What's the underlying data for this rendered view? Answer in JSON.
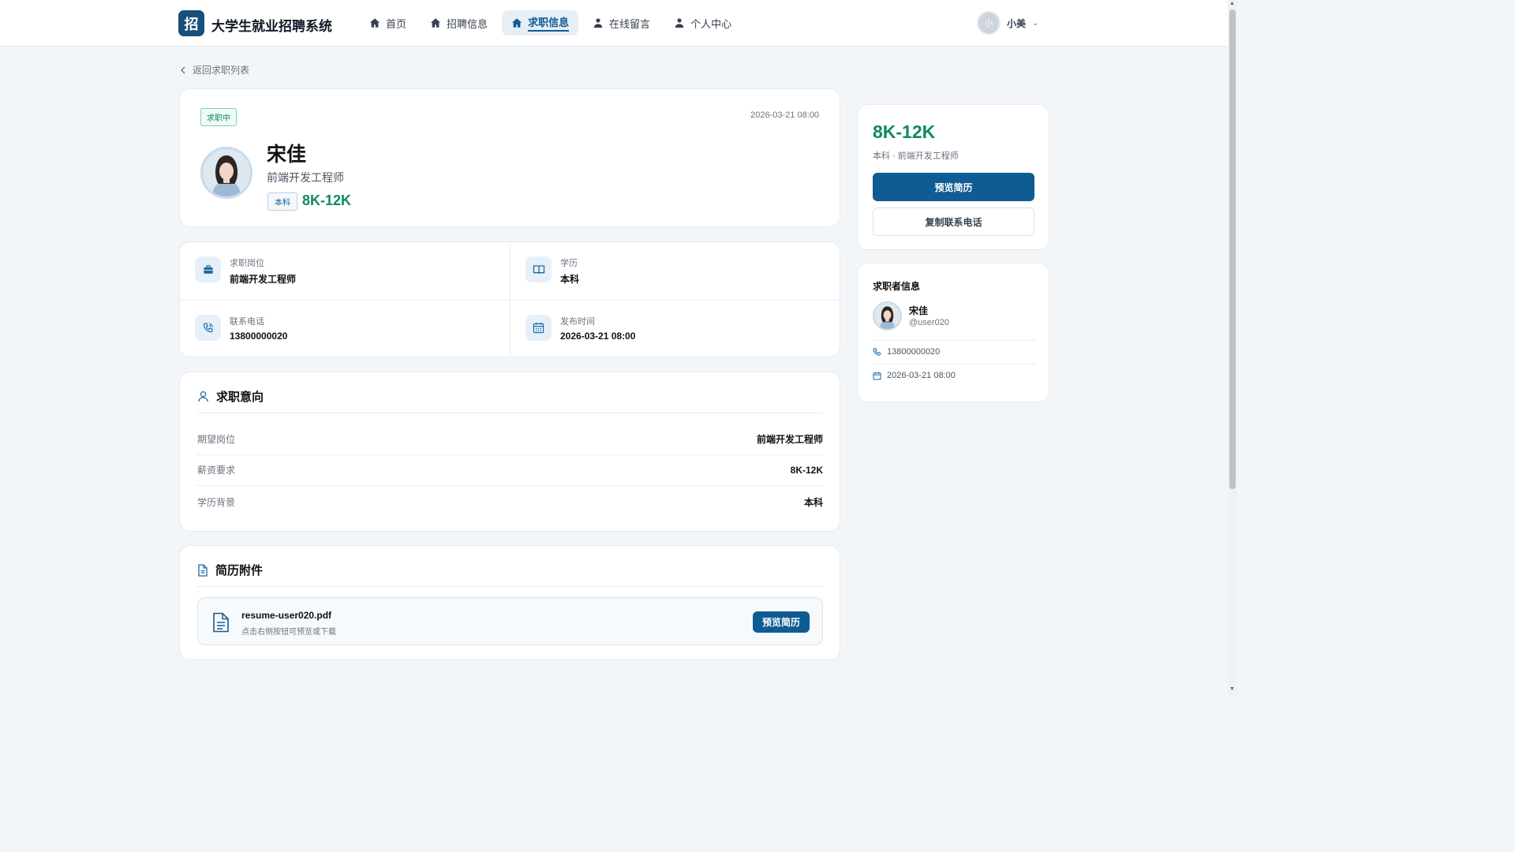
{
  "header": {
    "logo_char": "招",
    "app_title": "大学生就业招聘系统",
    "nav": [
      {
        "label": "首页",
        "icon": "home-icon"
      },
      {
        "label": "招聘信息",
        "icon": "home-icon"
      },
      {
        "label": "求职信息",
        "icon": "home-icon",
        "active": true
      },
      {
        "label": "在线留言",
        "icon": "user-icon"
      },
      {
        "label": "个人中心",
        "icon": "user-icon"
      }
    ],
    "user": {
      "avatar_char": "小",
      "name": "小美"
    }
  },
  "back_link": "返回求职列表",
  "profile": {
    "status": "求职中",
    "publish_time": "2026-03-21 08:00",
    "name": "宋佳",
    "title": "前端开发工程师",
    "education": "本科",
    "salary": "8K-12K"
  },
  "info_grid": [
    {
      "label": "求职岗位",
      "value": "前端开发工程师",
      "icon": "briefcase-icon"
    },
    {
      "label": "学历",
      "value": "本科",
      "icon": "book-icon"
    },
    {
      "label": "联系电话",
      "value": "13800000020",
      "icon": "phone-icon"
    },
    {
      "label": "发布时间",
      "value": "2026-03-21 08:00",
      "icon": "calendar-icon"
    }
  ],
  "intent": {
    "title": "求职意向",
    "rows": [
      {
        "key": "期望岗位",
        "value": "前端开发工程师"
      },
      {
        "key": "薪资要求",
        "value": "8K-12K"
      },
      {
        "key": "学历背景",
        "value": "本科"
      }
    ]
  },
  "resume": {
    "title": "简历附件",
    "file_name": "resume-user020.pdf",
    "hint": "点击右侧按钮可预览或下载",
    "button": "预览简历"
  },
  "side": {
    "salary": "8K-12K",
    "subline": "本科 · 前端开发工程师",
    "preview_button": "预览简历",
    "copy_button": "复制联系电话"
  },
  "seeker": {
    "title": "求职者信息",
    "name": "宋佳",
    "handle": "@user020",
    "phone": "13800000020",
    "time": "2026-03-21 08:00"
  },
  "colors": {
    "primary": "#0f5b93",
    "salary_green": "#108a5e",
    "status_green": "#0f8a5f",
    "logo_bg": "#1a4f7a"
  }
}
